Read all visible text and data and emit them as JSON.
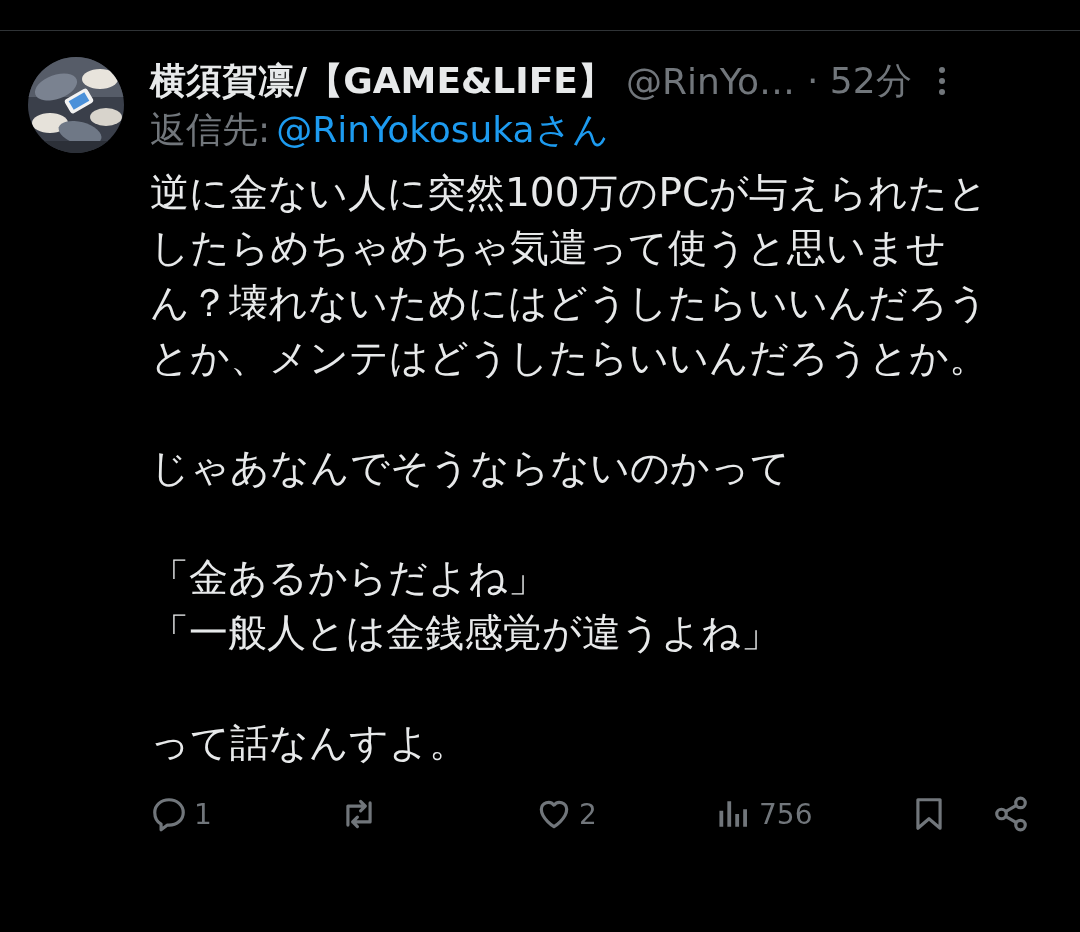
{
  "tweet": {
    "display_name": "横須賀凛/【GAME&LIFE】",
    "handle": "@RinYo…",
    "time": "· 52分",
    "reply_to_label": "返信先:",
    "reply_to_handle": "@RinYokosukaさん",
    "paragraphs": [
      "逆に金ない人に突然100万のPCが与えられたとしたらめちゃめちゃ気遣って使うと思いません？壊れないためにはどうしたらいいんだろうとか、メンテはどうしたらいいんだろうとか。",
      "じゃあなんでそうならないのかって",
      [
        "「金あるからだよね」",
        "「一般人とは金銭感覚が違うよね」"
      ],
      "って話なんすよ。"
    ]
  },
  "actions": [
    {
      "kind": "reply",
      "count": "1"
    },
    {
      "kind": "repost"
    },
    {
      "kind": "like",
      "count": "2"
    },
    {
      "kind": "views",
      "count": "756"
    },
    {
      "kind": "bookmark"
    },
    {
      "kind": "share"
    }
  ]
}
